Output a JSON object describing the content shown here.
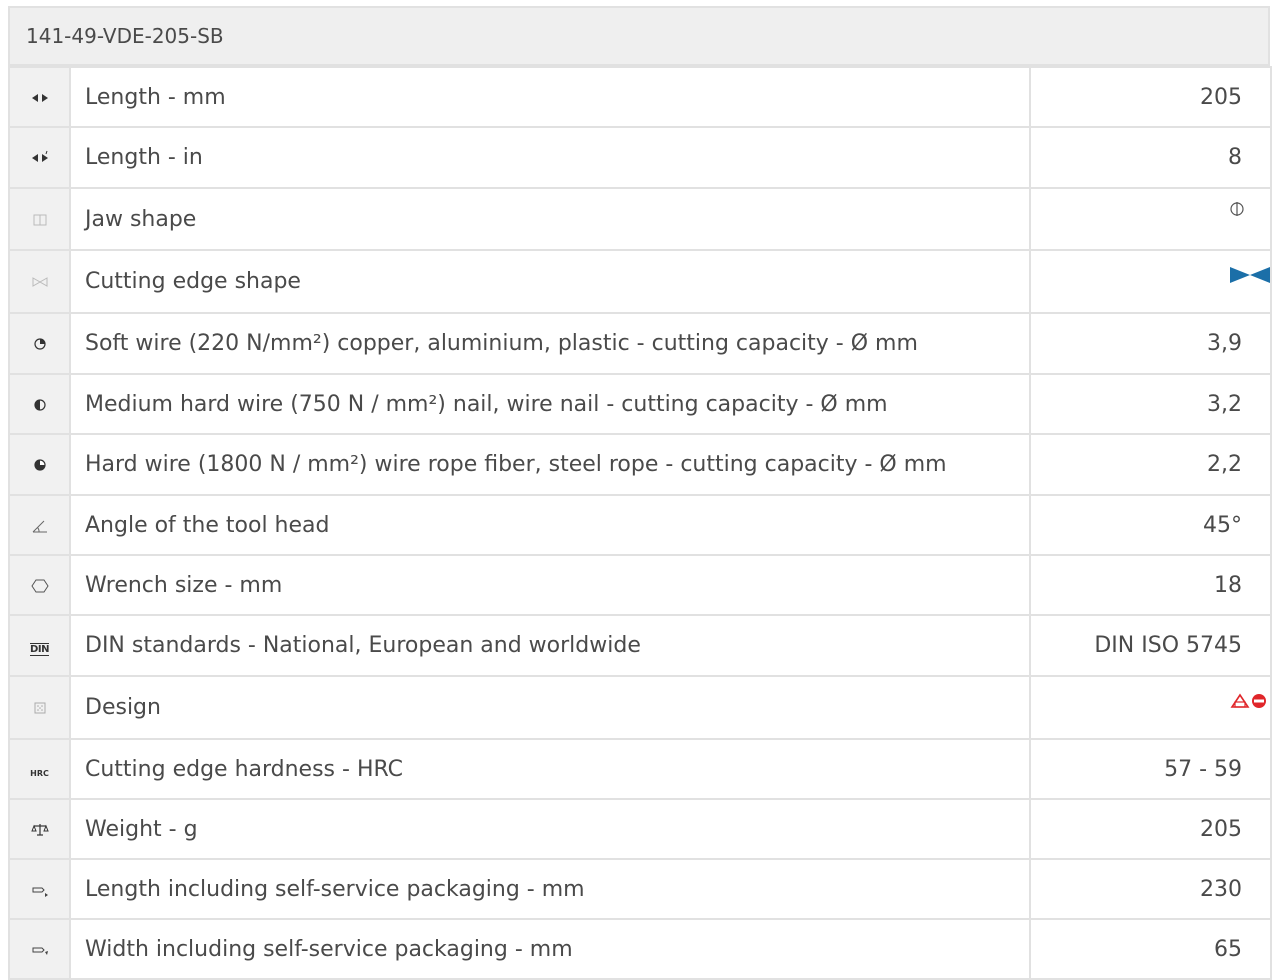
{
  "header": {
    "title": "141-49-VDE-205-SB"
  },
  "rows": [
    {
      "icon": "length-arrows-icon",
      "label": "Length - mm",
      "value": "205"
    },
    {
      "icon": "length-inch-arrows-icon",
      "label": "Length - in",
      "value": "8"
    },
    {
      "icon": "jaw-shape-icon",
      "label": "Jaw shape",
      "value": "",
      "value_icon": "jaw-round-symbol-icon"
    },
    {
      "icon": "cutting-edge-shape-icon",
      "label": "Cutting edge shape",
      "value": "",
      "value_icon": "bowtie-blue-icon"
    },
    {
      "icon": "soft-wire-quarter-circle-icon",
      "label": "Soft wire (220 N/mm²) copper, aluminium, plastic - cutting capacity - Ø mm",
      "value": "3,9"
    },
    {
      "icon": "medium-wire-half-circle-icon",
      "label": "Medium hard wire (750 N / mm²) nail, wire nail - cutting capacity - Ø mm",
      "value": "3,2"
    },
    {
      "icon": "hard-wire-three-quarter-circle-icon",
      "label": "Hard wire (1800 N / mm²) wire rope fiber, steel rope - cutting capacity - Ø mm",
      "value": "2,2"
    },
    {
      "icon": "angle-icon",
      "label": "Angle of the tool head",
      "value": "45°"
    },
    {
      "icon": "hexagon-icon",
      "label": "Wrench size - mm",
      "value": "18"
    },
    {
      "icon": "din-icon",
      "label": "DIN standards - National, European and worldwide",
      "value": "DIN ISO 5745"
    },
    {
      "icon": "design-pattern-icon",
      "label": "Design",
      "value": "",
      "value_icon": "design-red-logo-icon"
    },
    {
      "icon": "hrc-icon",
      "label": "Cutting edge hardness - HRC",
      "value": "57 - 59"
    },
    {
      "icon": "scale-icon",
      "label": "Weight - g",
      "value": "205"
    },
    {
      "icon": "package-length-icon",
      "label": "Length including self-service packaging - mm",
      "value": "230"
    },
    {
      "icon": "package-width-icon",
      "label": "Width including self-service packaging - mm",
      "value": "65"
    }
  ],
  "din_icon_text": "DIN",
  "hrc_icon_text": "HRC",
  "colors": {
    "accent_blue": "#1b6fa8",
    "design_red": "#e0262a"
  }
}
